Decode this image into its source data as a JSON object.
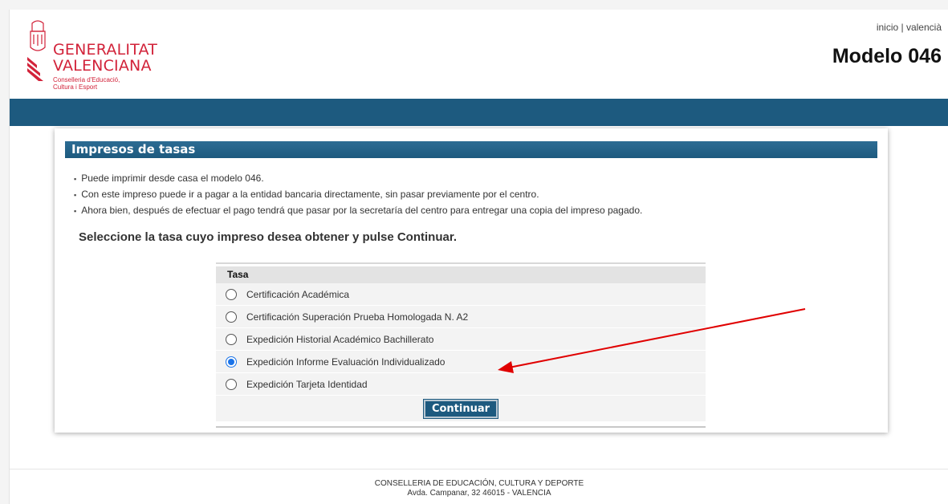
{
  "header": {
    "logo_line1": "GENERALITAT",
    "logo_line2": "VALENCIANA",
    "logo_sub1": "Conselleria d'Educació,",
    "logo_sub2": "Cultura i Esport",
    "link_inicio": "inicio",
    "link_separator": " | ",
    "link_valencia": "valencià",
    "title": "Modelo 046"
  },
  "panel": {
    "title": "Impresos de tasas",
    "bullets": [
      "Puede imprimir desde casa el modelo 046.",
      "Con este impreso puede ir a pagar a la entidad bancaria directamente, sin pasar previamente por el centro.",
      "Ahora bien, después de efectuar el pago tendrá que pasar por la secretaría del centro para entregar una copia del impreso pagado."
    ],
    "instruction": "Seleccione la tasa cuyo impreso desea obtener y pulse Continuar.",
    "table_header": "Tasa",
    "options": [
      {
        "label": "Certificación Académica",
        "selected": false
      },
      {
        "label": "Certificación Superación Prueba Homologada N. A2",
        "selected": false
      },
      {
        "label": "Expedición Historial Académico Bachillerato",
        "selected": false
      },
      {
        "label": "Expedición Informe Evaluación Individualizado",
        "selected": true
      },
      {
        "label": "Expedición Tarjeta Identidad",
        "selected": false
      }
    ],
    "button_label": "Continuar"
  },
  "footer": {
    "line1": "CONSELLERIA DE EDUCACIÓN, CULTURA Y DEPORTE",
    "line2": "Avda. Campanar, 32 46015 - VALENCIA"
  },
  "colors": {
    "brand_red": "#d2233a",
    "band_blue": "#1d5a7f",
    "annotation_arrow": "#e00000",
    "radio_selected": "#1a73e8"
  }
}
